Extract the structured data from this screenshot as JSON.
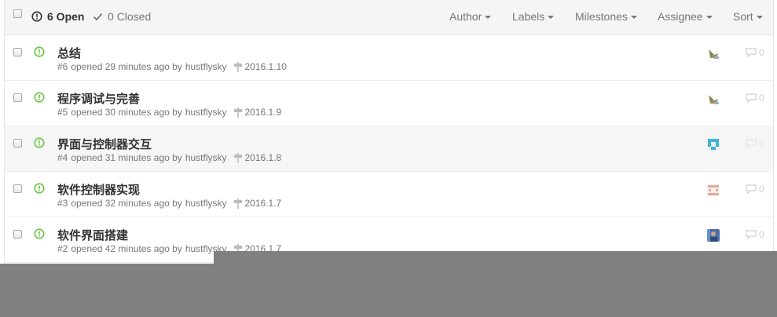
{
  "header": {
    "open_label": "6 Open",
    "closed_label": "0 Closed",
    "filters": [
      {
        "label": "Author"
      },
      {
        "label": "Labels"
      },
      {
        "label": "Milestones"
      },
      {
        "label": "Assignee"
      },
      {
        "label": "Sort"
      }
    ]
  },
  "colors": {
    "open_green": "#6cc644",
    "header_bg": "#f5f5f5",
    "overlay_gray": "#808080"
  },
  "issues": [
    {
      "title": "总结",
      "number": "#6",
      "opened": "opened 29 minutes ago by",
      "author": "hustflysky",
      "milestone": "2016.1.10",
      "comments": "0",
      "avatar_icon": "avatar-bird-icon"
    },
    {
      "title": "程序调试与完善",
      "number": "#5",
      "opened": "opened 30 minutes ago by",
      "author": "hustflysky",
      "milestone": "2016.1.9",
      "comments": "0",
      "avatar_icon": "avatar-bird-icon"
    },
    {
      "title": "界面与控制器交互",
      "number": "#4",
      "opened": "opened 31 minutes ago by",
      "author": "hustflysky",
      "milestone": "2016.1.8",
      "comments": "0",
      "avatar_icon": "avatar-identicon-teal-icon"
    },
    {
      "title": "软件控制器实现",
      "number": "#3",
      "opened": "opened 32 minutes ago by",
      "author": "hustflysky",
      "milestone": "2016.1.7",
      "comments": "0",
      "avatar_icon": "avatar-identicon-pink-icon"
    },
    {
      "title": "软件界面搭建",
      "number": "#2",
      "opened": "opened 42 minutes ago by",
      "author": "hustflysky",
      "milestone": "2016.1.7",
      "comments": "0",
      "avatar_icon": "avatar-photo-icon"
    }
  ]
}
